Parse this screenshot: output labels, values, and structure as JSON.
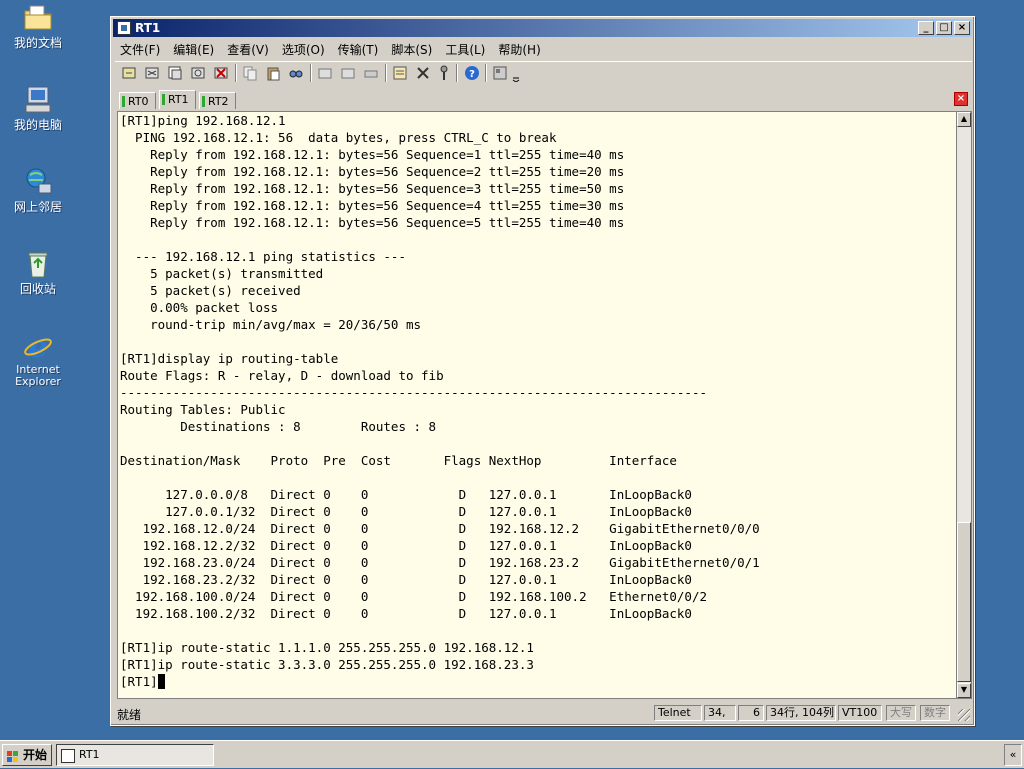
{
  "desktop": {
    "icons": [
      {
        "label": "我的文档"
      },
      {
        "label": "我的电脑"
      },
      {
        "label": "网上邻居"
      },
      {
        "label": "回收站"
      },
      {
        "label": "Internet Explorer"
      }
    ]
  },
  "window": {
    "title": "RT1",
    "buttons": {
      "minimize": "_",
      "maximize": "□",
      "close": "×"
    }
  },
  "menu": {
    "items": [
      "文件(F)",
      "编辑(E)",
      "查看(V)",
      "选项(O)",
      "传输(T)",
      "脚本(S)",
      "工具(L)",
      "帮助(H)"
    ]
  },
  "tabs": {
    "items": [
      "RT0",
      "RT1",
      "RT2"
    ],
    "active": "RT1"
  },
  "terminal": {
    "lines": [
      "[RT1]ping 192.168.12.1",
      "  PING 192.168.12.1: 56  data bytes, press CTRL_C to break",
      "    Reply from 192.168.12.1: bytes=56 Sequence=1 ttl=255 time=40 ms",
      "    Reply from 192.168.12.1: bytes=56 Sequence=2 ttl=255 time=20 ms",
      "    Reply from 192.168.12.1: bytes=56 Sequence=3 ttl=255 time=50 ms",
      "    Reply from 192.168.12.1: bytes=56 Sequence=4 ttl=255 time=30 ms",
      "    Reply from 192.168.12.1: bytes=56 Sequence=5 ttl=255 time=40 ms",
      "",
      "  --- 192.168.12.1 ping statistics ---",
      "    5 packet(s) transmitted",
      "    5 packet(s) received",
      "    0.00% packet loss",
      "    round-trip min/avg/max = 20/36/50 ms",
      "",
      "[RT1]display ip routing-table",
      "Route Flags: R - relay, D - download to fib",
      "------------------------------------------------------------------------------",
      "Routing Tables: Public",
      "        Destinations : 8        Routes : 8",
      "",
      "Destination/Mask    Proto  Pre  Cost       Flags NextHop         Interface",
      "",
      "      127.0.0.0/8   Direct 0    0            D   127.0.0.1       InLoopBack0",
      "      127.0.0.1/32  Direct 0    0            D   127.0.0.1       InLoopBack0",
      "   192.168.12.0/24  Direct 0    0            D   192.168.12.2    GigabitEthernet0/0/0",
      "   192.168.12.2/32  Direct 0    0            D   127.0.0.1       InLoopBack0",
      "   192.168.23.0/24  Direct 0    0            D   192.168.23.2    GigabitEthernet0/0/1",
      "   192.168.23.2/32  Direct 0    0            D   127.0.0.1       InLoopBack0",
      "  192.168.100.0/24  Direct 0    0            D   192.168.100.2   Ethernet0/0/2",
      "  192.168.100.2/32  Direct 0    0            D   127.0.0.1       InLoopBack0",
      "",
      "[RT1]ip route-static 1.1.1.0 255.255.255.0 192.168.12.1",
      "[RT1]ip route-static 3.3.3.0 255.255.255.0 192.168.23.3"
    ],
    "prompt": "[RT1]"
  },
  "status": {
    "ready": "就绪",
    "protocol": "Telnet",
    "row": "34,",
    "col": "6",
    "size": "34行, 104列",
    "term_type": "VT100",
    "caps": "大写",
    "num": "数字"
  },
  "taskbar": {
    "start": "开始",
    "task": "RT1",
    "tray": "«"
  },
  "colors": {
    "desktop": "#3a6ea5",
    "titlebar_start": "#0a246a",
    "titlebar_end": "#a6caf0",
    "terminal_bg": "#fffde8"
  }
}
